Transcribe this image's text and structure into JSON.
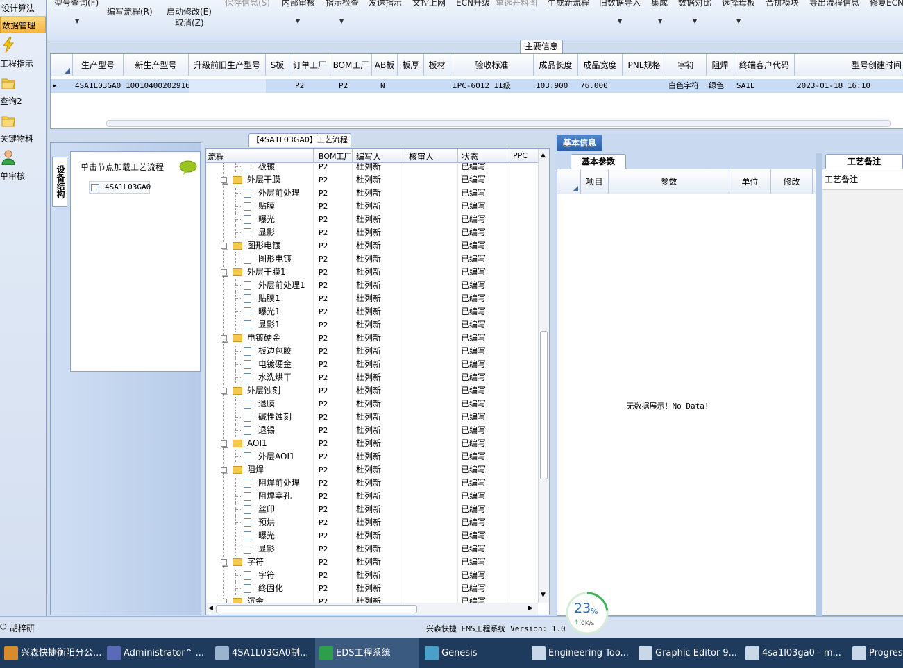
{
  "leftnav": {
    "top_items": [
      "设计算法",
      "数据管理"
    ],
    "items": [
      {
        "label": "工程指示",
        "icon": "lightning-icon"
      },
      {
        "label": "查询2",
        "icon": "folder-icon"
      },
      {
        "label": "关键物料",
        "icon": "folder-icon"
      },
      {
        "label": "单审核",
        "icon": "user-icon"
      }
    ]
  },
  "toolbar": {
    "row1": [
      "型号查询(F)",
      "保存信息(S)",
      "内部审核",
      "指示检查",
      "发送指示",
      "文控上网",
      "ECN升级",
      "重选开料图",
      "生成新流程",
      "旧数据导入",
      "集成",
      "数据对比",
      "选择母板",
      "合拼模块",
      "导出流程信息",
      "修复ECN"
    ],
    "write_flow": "编写流程(R)",
    "start_edit": "启动修改(E)",
    "cancel": "取消(Z)"
  },
  "main_info": {
    "title": "主要信息",
    "columns": [
      "生产型号",
      "新生产型号",
      "升级前旧生产型号",
      "S板",
      "订单工厂",
      "BOM工厂",
      "AB板",
      "板厚",
      "板材",
      "验收标准",
      "成品长度",
      "成品宽度",
      "PNL规格",
      "字符",
      "阻焊",
      "终端客户代码",
      "型号创建时间"
    ],
    "row": [
      "4SA1L03GA0",
      "10010400202916",
      "",
      "",
      "P2",
      "P2",
      "N",
      "",
      "",
      "IPC-6012 II级",
      "103.900",
      "76.000",
      "",
      "白色字符",
      "绿色",
      "SA1L",
      "2023-01-18 16:10"
    ]
  },
  "device_tree": {
    "tab_label": "设备结构",
    "header": "单击节点加载工艺流程",
    "node": "4SA1L03GA0"
  },
  "process_flow": {
    "title": "【4SA1L03GA0】工艺流程",
    "columns": [
      "流程",
      "BOM工厂",
      "编写人",
      "核审人",
      "状态",
      "PPC"
    ],
    "rows": [
      {
        "name": "板镀",
        "level": 2,
        "bom": "P2",
        "writer": "杜列新",
        "status": "已编写"
      },
      {
        "name": "外层干膜",
        "level": 1,
        "bom": "P2",
        "writer": "杜列新",
        "status": "已编写"
      },
      {
        "name": "外层前处理",
        "level": 2,
        "bom": "P2",
        "writer": "杜列新",
        "status": "已编写"
      },
      {
        "name": "贴膜",
        "level": 2,
        "bom": "P2",
        "writer": "杜列新",
        "status": "已编写"
      },
      {
        "name": "曝光",
        "level": 2,
        "bom": "P2",
        "writer": "杜列新",
        "status": "已编写"
      },
      {
        "name": "显影",
        "level": 2,
        "bom": "P2",
        "writer": "杜列新",
        "status": "已编写"
      },
      {
        "name": "图形电镀",
        "level": 1,
        "bom": "P2",
        "writer": "杜列新",
        "status": "已编写"
      },
      {
        "name": "图形电镀",
        "level": 2,
        "bom": "P2",
        "writer": "杜列新",
        "status": "已编写"
      },
      {
        "name": "外层干膜1",
        "level": 1,
        "bom": "P2",
        "writer": "杜列新",
        "status": "已编写"
      },
      {
        "name": "外层前处理1",
        "level": 2,
        "bom": "P2",
        "writer": "杜列新",
        "status": "已编写"
      },
      {
        "name": "贴膜1",
        "level": 2,
        "bom": "P2",
        "writer": "杜列新",
        "status": "已编写"
      },
      {
        "name": "曝光1",
        "level": 2,
        "bom": "P2",
        "writer": "杜列新",
        "status": "已编写"
      },
      {
        "name": "显影1",
        "level": 2,
        "bom": "P2",
        "writer": "杜列新",
        "status": "已编写"
      },
      {
        "name": "电镀硬金",
        "level": 1,
        "bom": "P2",
        "writer": "杜列新",
        "status": "已编写"
      },
      {
        "name": "板边包胶",
        "level": 2,
        "bom": "P2",
        "writer": "杜列新",
        "status": "已编写"
      },
      {
        "name": "电镀硬金",
        "level": 2,
        "bom": "P2",
        "writer": "杜列新",
        "status": "已编写"
      },
      {
        "name": "水洗烘干",
        "level": 2,
        "bom": "P2",
        "writer": "杜列新",
        "status": "已编写"
      },
      {
        "name": "外层蚀刻",
        "level": 1,
        "bom": "P2",
        "writer": "杜列新",
        "status": "已编写"
      },
      {
        "name": "退膜",
        "level": 2,
        "bom": "P2",
        "writer": "杜列新",
        "status": "已编写"
      },
      {
        "name": "碱性蚀刻",
        "level": 2,
        "bom": "P2",
        "writer": "杜列新",
        "status": "已编写"
      },
      {
        "name": "退锡",
        "level": 2,
        "bom": "P2",
        "writer": "杜列新",
        "status": "已编写"
      },
      {
        "name": "AOI1",
        "level": 1,
        "bom": "P2",
        "writer": "杜列新",
        "status": "已编写"
      },
      {
        "name": "外层AOI1",
        "level": 2,
        "bom": "P2",
        "writer": "杜列新",
        "status": "已编写"
      },
      {
        "name": "阻焊",
        "level": 1,
        "bom": "P2",
        "writer": "杜列新",
        "status": "已编写"
      },
      {
        "name": "阻焊前处理",
        "level": 2,
        "bom": "P2",
        "writer": "杜列新",
        "status": "已编写"
      },
      {
        "name": "阻焊塞孔",
        "level": 2,
        "bom": "P2",
        "writer": "杜列新",
        "status": "已编写"
      },
      {
        "name": "丝印",
        "level": 2,
        "bom": "P2",
        "writer": "杜列新",
        "status": "已编写"
      },
      {
        "name": "预烘",
        "level": 2,
        "bom": "P2",
        "writer": "杜列新",
        "status": "已编写"
      },
      {
        "name": "曝光",
        "level": 2,
        "bom": "P2",
        "writer": "杜列新",
        "status": "已编写"
      },
      {
        "name": "显影",
        "level": 2,
        "bom": "P2",
        "writer": "杜列新",
        "status": "已编写"
      },
      {
        "name": "字符",
        "level": 1,
        "bom": "P2",
        "writer": "杜列新",
        "status": "已编写"
      },
      {
        "name": "字符",
        "level": 2,
        "bom": "P2",
        "writer": "杜列新",
        "status": "已编写"
      },
      {
        "name": "终固化",
        "level": 2,
        "bom": "P2",
        "writer": "杜列新",
        "status": "已编写"
      },
      {
        "name": "沉金",
        "level": 1,
        "bom": "P2",
        "writer": "杜列新",
        "status": "已编写"
      }
    ]
  },
  "basic_info": {
    "tab": "基本信息",
    "subtab": "基本参数",
    "columns": [
      "项目",
      "参数",
      "单位",
      "修改"
    ],
    "empty": "无数据展示！No Data!"
  },
  "process_notes": {
    "tab": "工艺备注",
    "field_label": "工艺备注"
  },
  "statusbar": {
    "user": "胡梓研",
    "system": "兴森快捷 EMS工程系统 Version: 1.0"
  },
  "speed_widget": {
    "percent": "23",
    "unit": "%",
    "speed": "0K/s",
    "progress": 0.23
  },
  "taskbar": {
    "items": [
      {
        "label": "兴森快捷衡阳分公...",
        "color": "#d98a2b"
      },
      {
        "label": "Administrator^ ...",
        "color": "#5a6ab8"
      },
      {
        "label": "4SA1L03GA0制...",
        "color": "#9ab3cf"
      },
      {
        "label": "EDS工程系统",
        "color": "#2f9e4a",
        "active": true
      },
      {
        "label": "Genesis",
        "color": "#4aa0c8"
      },
      {
        "label": "Engineering Too...",
        "color": "#c9d8e8"
      },
      {
        "label": "Graphic Editor 9...",
        "color": "#c9d8e8"
      },
      {
        "label": "4sa1l03ga0 - m...",
        "color": "#c9d8e8"
      },
      {
        "label": "Progress",
        "color": "#c9d8e8"
      }
    ]
  }
}
